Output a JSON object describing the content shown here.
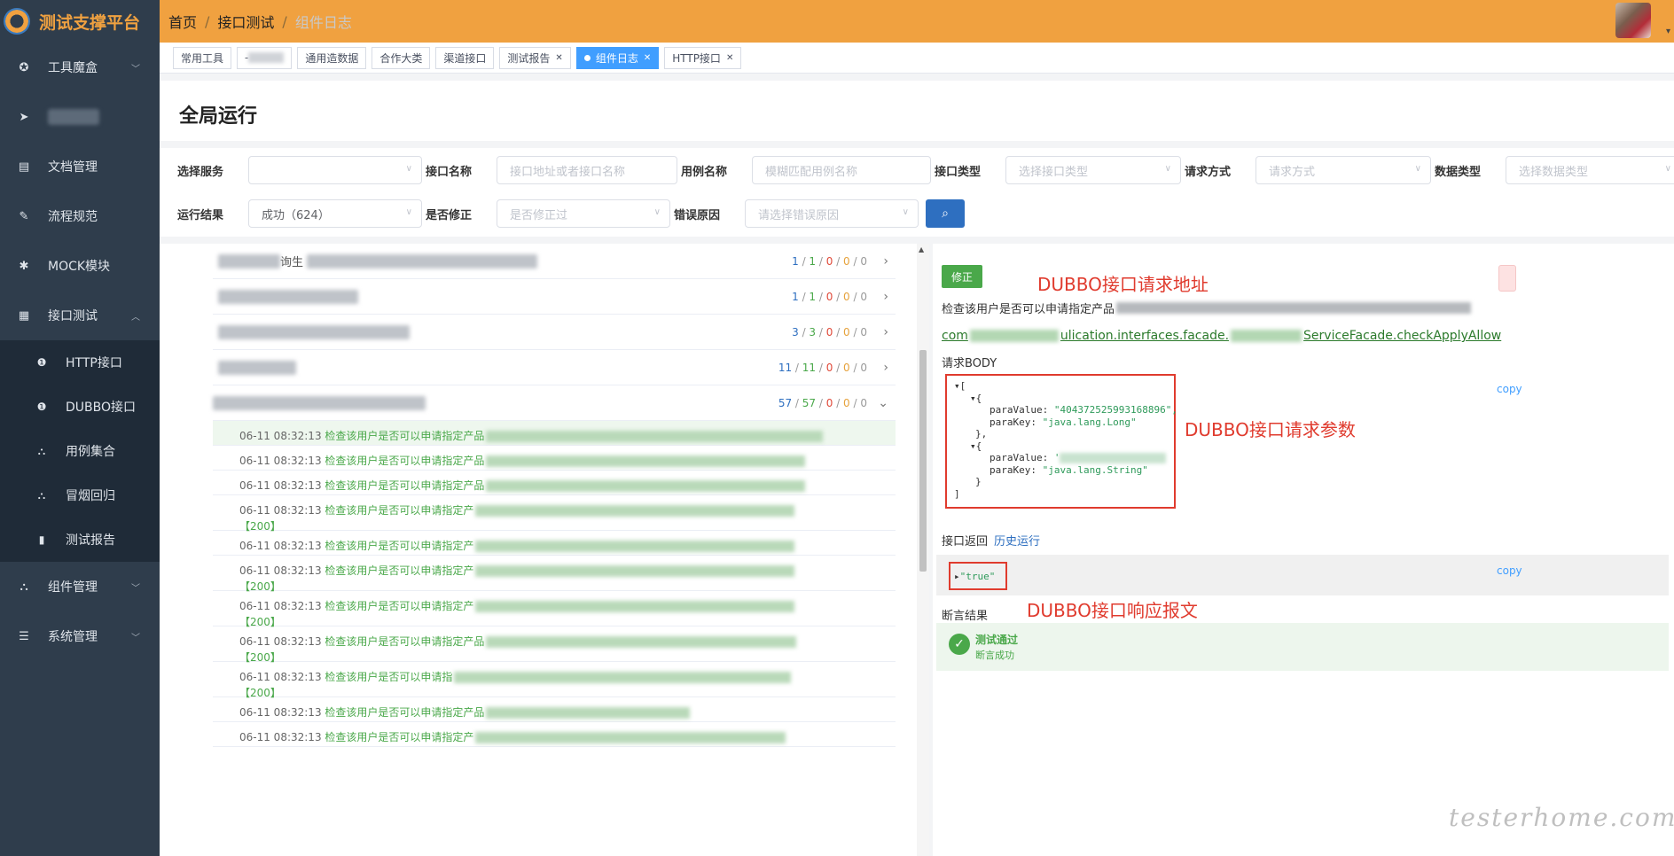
{
  "header": {
    "app_title": "测试支撑平台",
    "breadcrumb": [
      "首页",
      "接口测试",
      "组件日志"
    ],
    "separator": "/"
  },
  "sidebar": {
    "items": [
      {
        "label": "工具魔盒",
        "icon": "gear-icon",
        "expanded": false
      },
      {
        "label": "",
        "icon": "send-icon",
        "expanded": false
      },
      {
        "label": "文档管理",
        "icon": "document-icon",
        "expanded": false
      },
      {
        "label": "流程规范",
        "icon": "edit-icon",
        "expanded": false
      },
      {
        "label": "MOCK模块",
        "icon": "bug-icon",
        "expanded": false
      },
      {
        "label": "接口测试",
        "icon": "grid-icon",
        "expanded": true
      },
      {
        "label": "组件管理",
        "icon": "sitemap-icon",
        "expanded": false
      },
      {
        "label": "系统管理",
        "icon": "list-icon",
        "expanded": false
      }
    ],
    "subitems": [
      {
        "label": "HTTP接口",
        "icon": "info-icon"
      },
      {
        "label": "DUBBO接口",
        "icon": "info-icon"
      },
      {
        "label": "用例集合",
        "icon": "sitemap-icon"
      },
      {
        "label": "冒烟回归",
        "icon": "sitemap-icon"
      },
      {
        "label": "测试报告",
        "icon": "bar-chart-icon"
      }
    ]
  },
  "tabs": [
    {
      "label": "常用工具",
      "active": false,
      "closable": false
    },
    {
      "label": "",
      "active": false,
      "closable": false
    },
    {
      "label": "通用造数据",
      "active": false,
      "closable": false
    },
    {
      "label": "合作大类",
      "active": false,
      "closable": false
    },
    {
      "label": "渠道接口",
      "active": false,
      "closable": false
    },
    {
      "label": "测试报告",
      "active": false,
      "closable": true
    },
    {
      "label": "组件日志",
      "active": true,
      "closable": true
    },
    {
      "label": "HTTP接口",
      "active": false,
      "closable": true
    }
  ],
  "page": {
    "title": "全局运行"
  },
  "filters": {
    "row1": [
      {
        "label": "选择服务",
        "placeholder": "",
        "value": "",
        "dropdown": true
      },
      {
        "label": "接口名称",
        "placeholder": "接口地址或者接口名称",
        "value": "",
        "dropdown": false
      },
      {
        "label": "用例名称",
        "placeholder": "模糊匹配用例名称",
        "value": "",
        "dropdown": false
      },
      {
        "label": "接口类型",
        "placeholder": "选择接口类型",
        "value": "",
        "dropdown": true
      },
      {
        "label": "请求方式",
        "placeholder": "请求方式",
        "value": "",
        "dropdown": true
      },
      {
        "label": "数据类型",
        "placeholder": "选择数据类型",
        "value": "",
        "dropdown": true
      }
    ],
    "row2": [
      {
        "label": "运行结果",
        "placeholder": "",
        "value": "成功（624）",
        "dropdown": true
      },
      {
        "label": "是否修正",
        "placeholder": "是否修正过",
        "value": "",
        "dropdown": true
      },
      {
        "label": "错误原因",
        "placeholder": "请选择错误原因",
        "value": "",
        "dropdown": true
      }
    ],
    "search_icon": "search-icon"
  },
  "groups": [
    {
      "name_visible": "询生",
      "total": "1",
      "success": "1",
      "fail": "0",
      "warn": "0",
      "skip": "0",
      "expanded": false
    },
    {
      "name_visible": "",
      "total": "1",
      "success": "1",
      "fail": "0",
      "warn": "0",
      "skip": "0",
      "expanded": false
    },
    {
      "name_visible": "",
      "total": "3",
      "success": "3",
      "fail": "0",
      "warn": "0",
      "skip": "0",
      "expanded": false
    },
    {
      "name_visible": "",
      "total": "11",
      "success": "11",
      "fail": "0",
      "warn": "0",
      "skip": "0",
      "expanded": false
    },
    {
      "name_visible": "",
      "total": "57",
      "success": "57",
      "fail": "0",
      "warn": "0",
      "skip": "0",
      "expanded": true
    }
  ],
  "logs": [
    {
      "time": "06-11 08:32:13",
      "msg": "检查该用户是否可以申请指定产品",
      "code": "",
      "highlight": true
    },
    {
      "time": "06-11 08:32:13",
      "msg": "检查该用户是否可以申请指定产品",
      "code": "",
      "highlight": false
    },
    {
      "time": "06-11 08:32:13",
      "msg": "检查该用户是否可以申请指定产品",
      "code": "",
      "highlight": false
    },
    {
      "time": "06-11 08:32:13",
      "msg": "检查该用户是否可以申请指定产",
      "code": "【200】",
      "highlight": false
    },
    {
      "time": "06-11 08:32:13",
      "msg": "检查该用户是否可以申请指定产",
      "code": "",
      "highlight": false
    },
    {
      "time": "06-11 08:32:13",
      "msg": "检查该用户是否可以申请指定产",
      "code": "【200】",
      "highlight": false
    },
    {
      "time": "06-11 08:32:13",
      "msg": "检查该用户是否可以申请指定产",
      "code": "【200】",
      "highlight": false
    },
    {
      "time": "06-11 08:32:13",
      "msg": "检查该用户是否可以申请指定产品",
      "code": "【200】",
      "highlight": false
    },
    {
      "time": "06-11 08:32:13",
      "msg": "检查该用户是否可以申请指",
      "code": "【200】",
      "highlight": false
    },
    {
      "time": "06-11 08:32:13",
      "msg": "检查该用户是否可以申请指定产品",
      "code": "",
      "highlight": false
    },
    {
      "time": "06-11 08:32:13",
      "msg": "检查该用户是否可以申请指定产",
      "code": "",
      "highlight": false
    }
  ],
  "detail": {
    "fix_button": "修正",
    "description": "检查该用户是否可以申请指定产品",
    "interface_prefix": "com",
    "interface_mid": "ulication.interfaces.facade.",
    "interface_suffix": "ServiceFacade.checkApplyAllow",
    "body_label": "请求BODY",
    "copy_label": "copy",
    "json": {
      "open_bracket": "[",
      "close_bracket": "]",
      "obj_open": "{",
      "obj_close": "},",
      "obj_close_last": "}",
      "p1_value_key": "paraValue:",
      "p1_value": "\"404372525993168896\",",
      "p1_key_key": "paraKey:",
      "p1_key": "\"java.lang.Long\"",
      "p2_value_key": "paraValue:",
      "p2_value": "'",
      "p2_key_key": "paraKey:",
      "p2_key": "\"java.lang.String\""
    },
    "return_tab": "接口返回",
    "history_tab": "历史运行",
    "response": "\"true\"",
    "assert_label": "断言结果",
    "assert_title": "测试通过",
    "assert_sub": "断言成功"
  },
  "annotations": {
    "addr": "DUBBO接口请求地址",
    "params": "DUBBO接口请求参数",
    "resp": "DUBBO接口响应报文"
  },
  "watermark": "testerhome.com",
  "colors": {
    "header": "#f0a140",
    "sidebar": "#2f3d4c",
    "active_tab": "#409eff",
    "success": "#4aa84a",
    "annotation": "#e03b2e"
  }
}
